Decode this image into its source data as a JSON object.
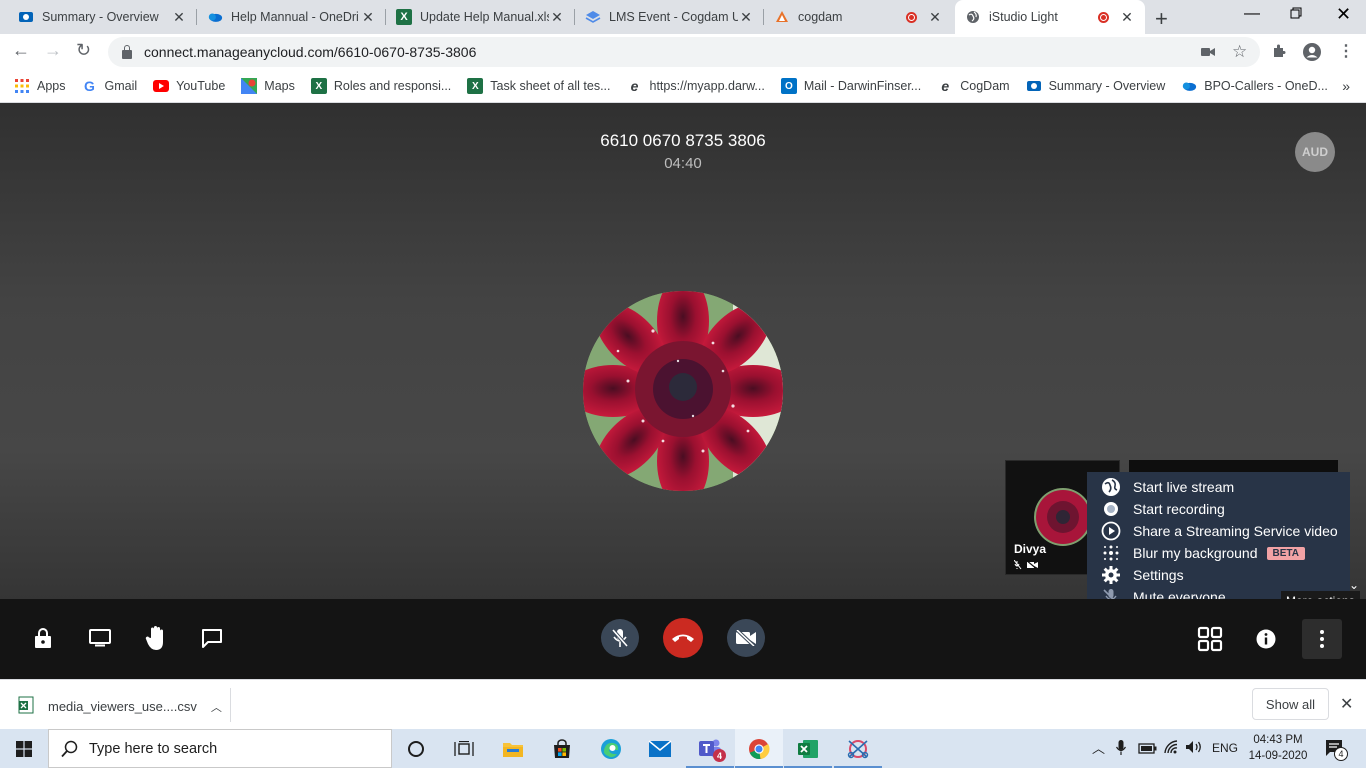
{
  "browser": {
    "tabs": [
      {
        "title": "Summary - Overview",
        "icon": "sharepoint-icon",
        "active": false
      },
      {
        "title": "Help Mannual - OneDri",
        "icon": "onedrive-icon",
        "active": false
      },
      {
        "title": "Update Help Manual.xlsx",
        "icon": "excel-icon",
        "active": false
      },
      {
        "title": "LMS Event - Cogdam Un",
        "icon": "layers-icon",
        "active": false
      },
      {
        "title": "cogdam",
        "icon": "cogdam-icon",
        "active": false,
        "recording": true
      },
      {
        "title": "iStudio Light",
        "icon": "globe-icon",
        "active": true,
        "recording": true
      }
    ],
    "url": "connect.manageanycloud.com/6610-0670-8735-3806",
    "bookmarks": [
      {
        "label": "Apps",
        "icon": "apps-grid-icon"
      },
      {
        "label": "Gmail",
        "icon": "google-icon"
      },
      {
        "label": "YouTube",
        "icon": "youtube-icon"
      },
      {
        "label": "Maps",
        "icon": "maps-icon"
      },
      {
        "label": "Roles and responsi...",
        "icon": "excel-icon"
      },
      {
        "label": "Task sheet of all tes...",
        "icon": "excel-icon"
      },
      {
        "label": "https://myapp.darw...",
        "icon": "edge-e-icon"
      },
      {
        "label": "Mail - DarwinFinser...",
        "icon": "outlook-icon"
      },
      {
        "label": "CogDam",
        "icon": "edge-e-icon"
      },
      {
        "label": "Summary - Overview",
        "icon": "sharepoint-icon"
      },
      {
        "label": "BPO-Callers - OneD...",
        "icon": "onedrive-icon"
      }
    ]
  },
  "meeting": {
    "id": "6610 0670 8735 3806",
    "timer": "04:40",
    "audio_badge": "AUD",
    "participant": {
      "name": "Divya"
    },
    "menu": {
      "items": [
        {
          "label": "Start live stream",
          "icon": "globe-icon"
        },
        {
          "label": "Start recording",
          "icon": "record-icon"
        },
        {
          "label": "Share a Streaming Service video",
          "icon": "play-circle-icon"
        },
        {
          "label": "Blur my background",
          "icon": "blur-icon",
          "badge": "BETA"
        },
        {
          "label": "Settings",
          "icon": "gear-icon"
        },
        {
          "label": "Mute everyone",
          "icon": "mic-off-icon"
        }
      ]
    },
    "tooltip": "More actions",
    "colors": {
      "hangup": "#cb2a21",
      "menu_bg": "#283447",
      "beta_badge": "#f2a2a5"
    }
  },
  "downloads": {
    "file": "media_viewers_use....csv",
    "show_all": "Show all"
  },
  "taskbar": {
    "search_placeholder": "Type here to search",
    "lang": "ENG",
    "time": "04:43 PM",
    "date": "14-09-2020",
    "notifications": "4",
    "teams_badge": "4"
  }
}
